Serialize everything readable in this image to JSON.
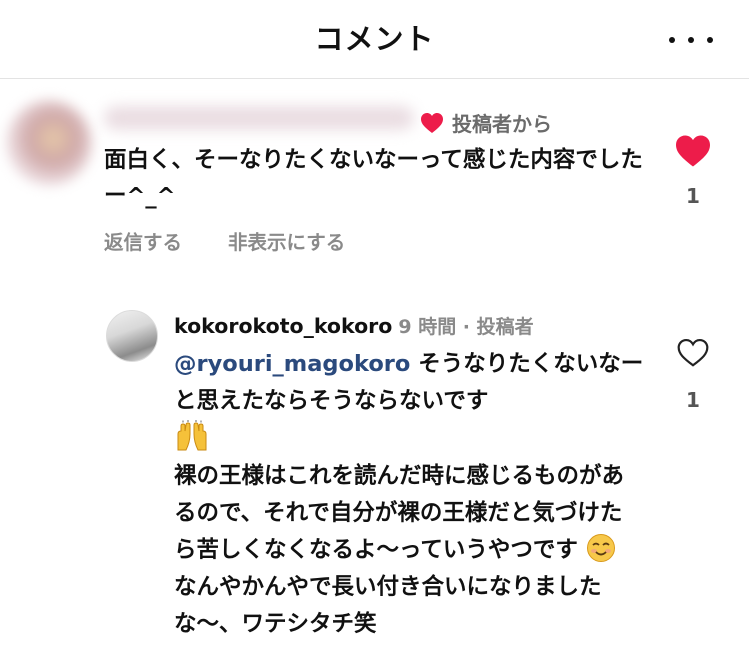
{
  "header": {
    "title": "コメント",
    "more_icon": "more-horizontal-icon"
  },
  "comment": {
    "creator_liked_label": "投稿者から",
    "text": "面白く、そーなりたくないなーって感じた内容でしたー^_^",
    "reply_action": "返信する",
    "hide_action": "非表示にする",
    "like_count": "1",
    "liked": true,
    "heart_color": "#ed1c4a"
  },
  "reply": {
    "username": "kokorokoto_kokoro",
    "info": "9 時間 · 投稿者",
    "mention": "@ryouri_magokoro",
    "line1": " そうなりたくないなーと思えたならそうならないです",
    "line2": "裸の王様はこれを読んだ時に感じるものがあるので、それで自分が裸の王様だと気づけたら苦しくなくなるよ〜っていうやつです",
    "line3": "なんやかんやで長い付き合いになりましたな〜、ワテシタチ笑",
    "like_count": "1",
    "liked": false,
    "emoji1": "raising-hands-emoji",
    "emoji2": "smiling-face-emoji",
    "mention_color": "#2b4a7d"
  }
}
